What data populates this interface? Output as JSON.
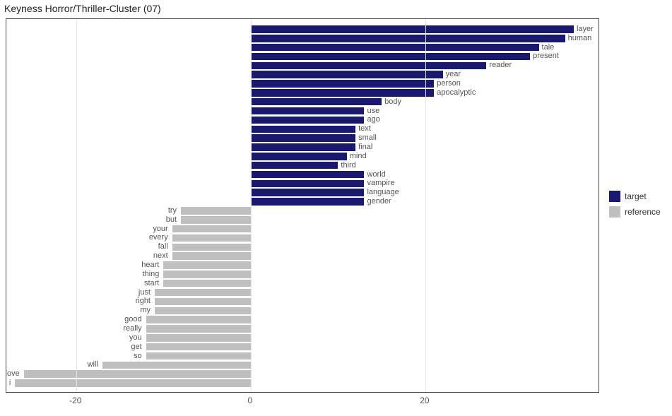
{
  "chart_data": {
    "type": "bar",
    "title": "Keyness Horror/Thriller-Cluster (07)",
    "xlabel": "",
    "ylabel": "",
    "xlim": [
      -28,
      40
    ],
    "x_ticks": [
      -20,
      0,
      20
    ],
    "legend": [
      "target",
      "reference"
    ],
    "series": [
      {
        "name": "target",
        "color": "#191970",
        "items": [
          {
            "label": "layer",
            "value": 37
          },
          {
            "label": "human",
            "value": 36
          },
          {
            "label": "tale",
            "value": 33
          },
          {
            "label": "present",
            "value": 32
          },
          {
            "label": "reader",
            "value": 27
          },
          {
            "label": "year",
            "value": 22
          },
          {
            "label": "person",
            "value": 21
          },
          {
            "label": "apocalyptic",
            "value": 21
          },
          {
            "label": "body",
            "value": 15
          },
          {
            "label": "use",
            "value": 13
          },
          {
            "label": "ago",
            "value": 13
          },
          {
            "label": "text",
            "value": 12
          },
          {
            "label": "small",
            "value": 12
          },
          {
            "label": "final",
            "value": 12
          },
          {
            "label": "mind",
            "value": 11
          },
          {
            "label": "third",
            "value": 10
          },
          {
            "label": "world",
            "value": 13
          },
          {
            "label": "vampire",
            "value": 13
          },
          {
            "label": "language",
            "value": 13
          },
          {
            "label": "gender",
            "value": 13
          }
        ]
      },
      {
        "name": "reference",
        "color": "#bfbfbf",
        "items": [
          {
            "label": "try",
            "value": -8
          },
          {
            "label": "but",
            "value": -8
          },
          {
            "label": "your",
            "value": -9
          },
          {
            "label": "every",
            "value": -9
          },
          {
            "label": "fall",
            "value": -9
          },
          {
            "label": "next",
            "value": -9
          },
          {
            "label": "heart",
            "value": -10
          },
          {
            "label": "thing",
            "value": -10
          },
          {
            "label": "start",
            "value": -10
          },
          {
            "label": "just",
            "value": -11
          },
          {
            "label": "right",
            "value": -11
          },
          {
            "label": "my",
            "value": -11
          },
          {
            "label": "good",
            "value": -12
          },
          {
            "label": "really",
            "value": -12
          },
          {
            "label": "you",
            "value": -12
          },
          {
            "label": "get",
            "value": -12
          },
          {
            "label": "so",
            "value": -12
          },
          {
            "label": "will",
            "value": -17
          },
          {
            "label": "love",
            "value": -26
          },
          {
            "label": "i",
            "value": -27
          }
        ]
      }
    ]
  }
}
